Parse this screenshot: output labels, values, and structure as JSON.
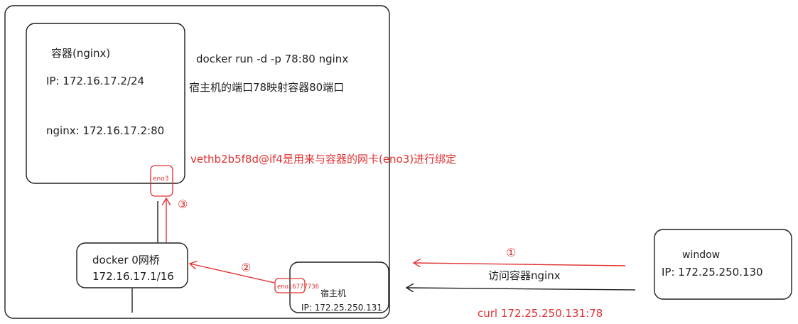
{
  "colors": {
    "ink": "#1e1e1e",
    "accent": "#e03131",
    "background": "#ffffff"
  },
  "container": {
    "title": "容器(nginx)",
    "ip": "IP: 172.16.17.2/24",
    "nginx": "nginx: 172.16.17.2:80"
  },
  "command": {
    "run": "docker run -d -p 78:80 nginx",
    "explain": "宿主机的端口78映射容器80端口"
  },
  "veth": {
    "note": "vethb2b5f8d@if4是用来与容器的网卡(eno3)进行绑定",
    "eno3_label": "eno3"
  },
  "bridge": {
    "title": "docker 0网桥",
    "ip": "172.16.17.1/16"
  },
  "host": {
    "interface_label": "eno16777736",
    "title": "宿主机",
    "ip": "IP: 172.25.250.131"
  },
  "window": {
    "title": "window",
    "ip": "IP: 172.25.250.130"
  },
  "steps": {
    "one": "①",
    "two": "②",
    "three": "③"
  },
  "access": {
    "label": "访问容器nginx",
    "curl": "curl 172.25.250.131:78"
  }
}
